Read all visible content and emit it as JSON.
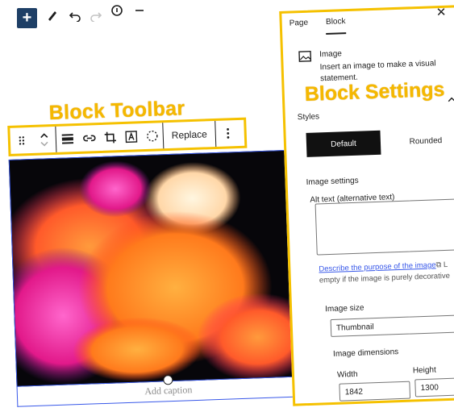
{
  "topbar": {
    "add_icon": "plus-icon",
    "tools": [
      "pencil-icon",
      "undo-icon",
      "redo-icon",
      "info-icon",
      "list-icon"
    ]
  },
  "annotations": {
    "toolbar": "Block Toolbar",
    "settings": "Block Settings"
  },
  "block_toolbar": {
    "replace_label": "Replace"
  },
  "editor": {
    "caption_placeholder": "Add caption"
  },
  "sidebar": {
    "tabs": [
      {
        "label": "Page"
      },
      {
        "label": "Block"
      }
    ],
    "block_card": {
      "title": "Image",
      "desc_line1": "Insert an image to make a visual",
      "desc_line2": "statement."
    },
    "styles": {
      "heading": "Styles",
      "default": "Default",
      "rounded": "Rounded"
    },
    "image_settings": {
      "heading": "Image settings",
      "alt_label": "Alt text (alternative text)",
      "alt_link": "Describe the purpose of the image",
      "alt_link_suffix": "⧉ L",
      "alt_help": "empty if the image is purely decorative"
    },
    "image_size": {
      "label": "Image size",
      "value": "Thumbnail"
    },
    "dimensions": {
      "heading": "Image dimensions",
      "width_label": "Width",
      "height_label": "Height",
      "width_value": "1842",
      "height_value": "1300"
    },
    "close_icon": "close-icon"
  },
  "colors": {
    "accent": "#f5c100",
    "dark": "#1e1e1e",
    "link": "#3858e9",
    "add_button": "#1e3f66"
  }
}
